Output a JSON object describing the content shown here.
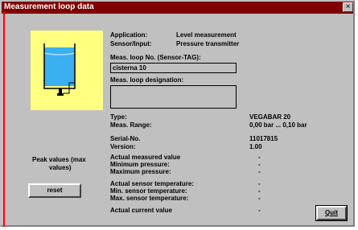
{
  "window": {
    "title": "Measurement loop data",
    "close_label": "×"
  },
  "info": {
    "application_label": "Application:",
    "application_value": "Level measurement",
    "sensor_label": "Sensor/Input:",
    "sensor_value": "Pressure transmitter",
    "loop_no_label": "Meas. loop No. (Sensor-TAG):",
    "loop_no_value": "cisterna 10",
    "designation_label": "Meas. loop designation:",
    "designation_value": "",
    "type_label": "Type:",
    "type_value": "VEGABAR 20",
    "range_label": "Meas. Range:",
    "range_value": "0,00 bar ... 0,10 bar",
    "serial_label": "Serial-No.",
    "serial_value": "11017815",
    "version_label": "Version:",
    "version_value": "1.00"
  },
  "peak": {
    "title_line1": "Peak values (max",
    "title_line2": "values)",
    "reset_label": "reset"
  },
  "measured": [
    {
      "label": "Actual measured value",
      "value": "-"
    },
    {
      "label": "Minimum pressure:",
      "value": "-"
    },
    {
      "label": "Maximum pressure:",
      "value": "-"
    }
  ],
  "temperature": [
    {
      "label": "Actual sensor temperature:",
      "value": "-"
    },
    {
      "label": "Min. sensor temperature:",
      "value": "-"
    },
    {
      "label": "Max. sensor temperature:",
      "value": "-"
    }
  ],
  "current": {
    "label": "Actual current value",
    "value": "-"
  },
  "quit_label": "Quit",
  "colors": {
    "title_bar": "#800000",
    "tank_bg": "#ffff80",
    "liquid": "#3ab0f0",
    "accent_line": "#ff0000"
  }
}
